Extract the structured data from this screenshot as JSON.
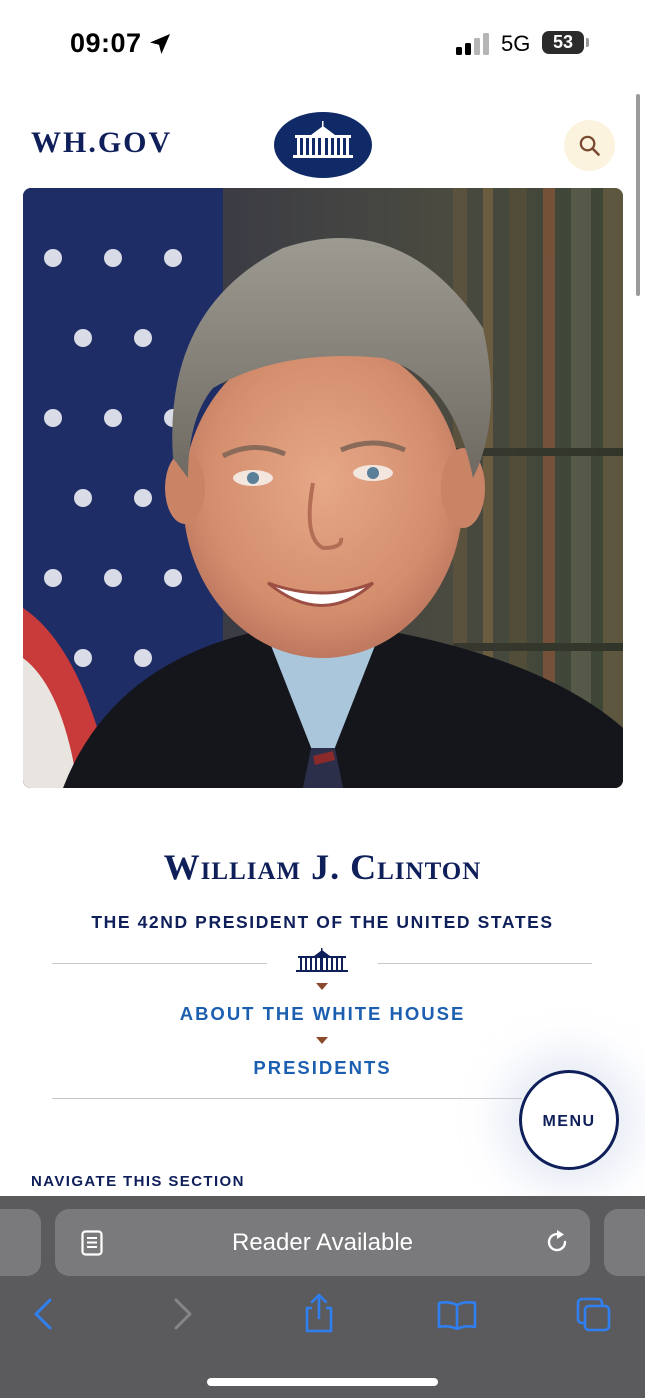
{
  "status_bar": {
    "time": "09:07",
    "network": "5G",
    "battery": "53",
    "icons": [
      "location-arrow-icon",
      "cellular-signal-icon",
      "battery-icon"
    ]
  },
  "header": {
    "logo": "WH.GOV",
    "seal_icon": "white-house-seal-icon",
    "search_icon": "search-icon"
  },
  "portrait": {
    "description_icon": "president-portrait-image"
  },
  "page": {
    "name": "William J. Clinton",
    "subtitle": "THE 42ND PRESIDENT OF THE UNITED STATES",
    "breadcrumbs": [
      {
        "label": "ABOUT THE WHITE HOUSE"
      },
      {
        "label": "PRESIDENTS"
      }
    ],
    "menu_label": "MENU",
    "navigate_label": "NAVIGATE THIS SECTION"
  },
  "browser": {
    "address_text": "Reader Available",
    "icons": [
      "reader-icon",
      "reload-icon",
      "back-icon",
      "forward-icon",
      "share-icon",
      "bookmarks-icon",
      "tabs-icon"
    ]
  },
  "colors": {
    "navy": "#0f1f5a",
    "link_blue": "#1c5fb0",
    "accent_brown": "#8b4a2b",
    "search_bg": "#fbf3de",
    "toolbar": "#5b5b5e",
    "toolbar_field": "#7a7a7c",
    "ios_blue": "#2f7ff1"
  }
}
